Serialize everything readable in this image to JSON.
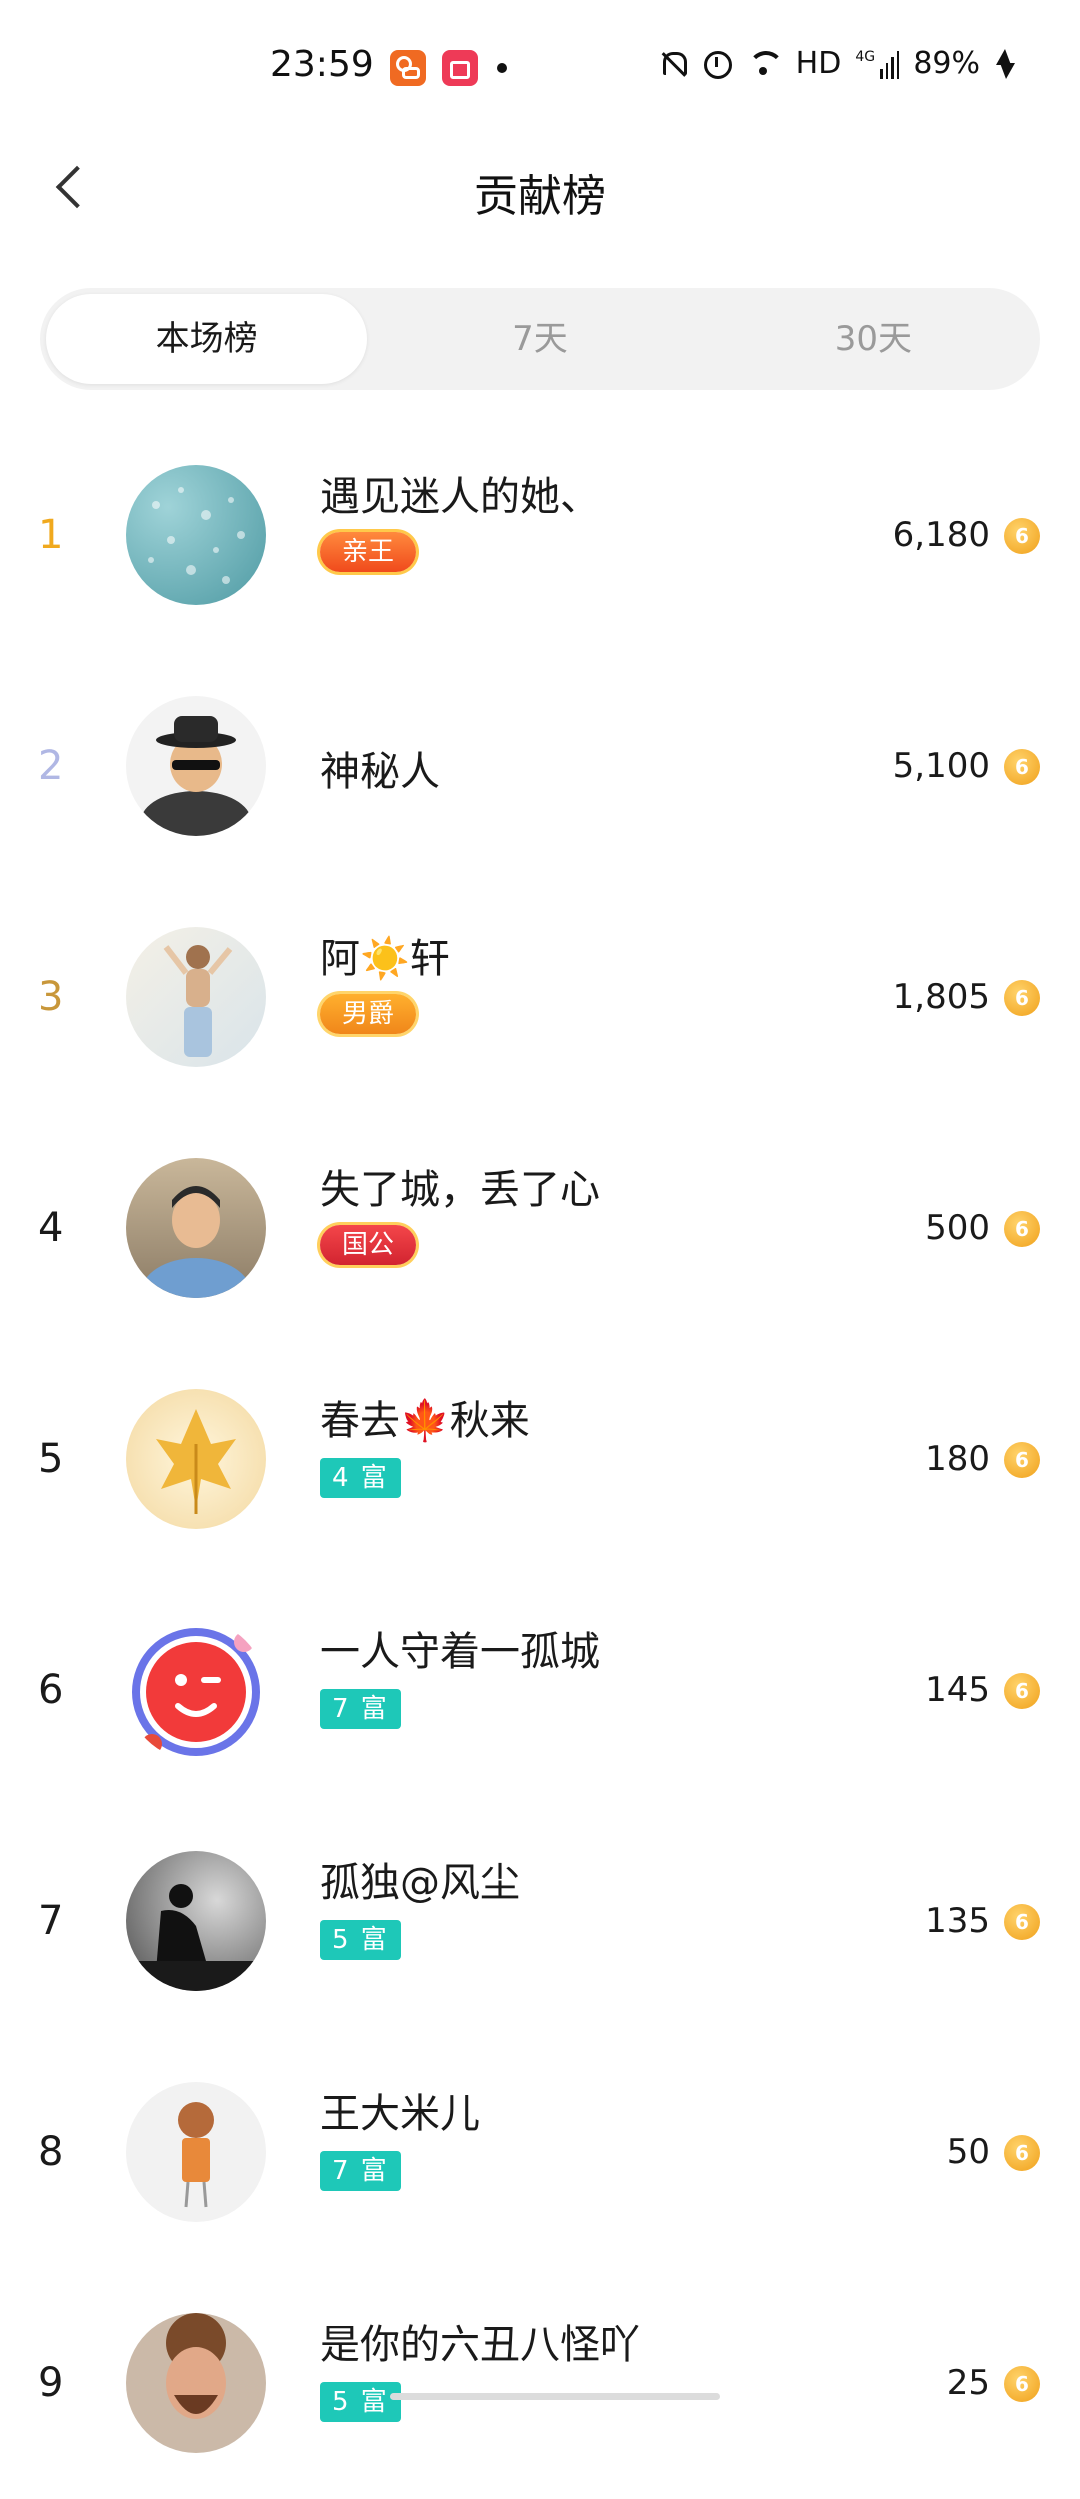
{
  "status_bar": {
    "time": "23:59",
    "network": "HD",
    "network_gen": "4G",
    "battery": "89%"
  },
  "header": {
    "title": "贡献榜"
  },
  "tabs": [
    {
      "label": "本场榜",
      "active": true
    },
    {
      "label": "7天",
      "active": false
    },
    {
      "label": "30天",
      "active": false
    }
  ],
  "rank_colors": {
    "1": "#f0a91e",
    "2": "#b0b7e4",
    "3": "#c8973a"
  },
  "coin_glyph": "6",
  "entries": [
    {
      "rank": "1",
      "name": "遇见迷人的她、",
      "badge": "亲王",
      "badge_type": "noble",
      "score": "6,180"
    },
    {
      "rank": "2",
      "name": "神秘人",
      "badge": "",
      "badge_type": "",
      "score": "5,100"
    },
    {
      "rank": "3",
      "name": "阿☀️轩",
      "badge": "男爵",
      "badge_type": "noble",
      "score": "1,805"
    },
    {
      "rank": "4",
      "name": "失了城，丢了心",
      "badge": "国公",
      "badge_type": "noble",
      "score": "500"
    },
    {
      "rank": "5",
      "name": "春去🍁秋来",
      "badge": "4 富",
      "badge_type": "rich",
      "score": "180"
    },
    {
      "rank": "6",
      "name": "一人守着一孤城",
      "badge": "7 富",
      "badge_type": "rich",
      "score": "145"
    },
    {
      "rank": "7",
      "name": "孤独@风尘",
      "badge": "5 富",
      "badge_type": "rich",
      "score": "135"
    },
    {
      "rank": "8",
      "name": "王大米儿",
      "badge": "7 富",
      "badge_type": "rich",
      "score": "50"
    },
    {
      "rank": "9",
      "name": "是你的六丑八怪吖",
      "badge": "5 富",
      "badge_type": "rich",
      "score": "25"
    }
  ]
}
